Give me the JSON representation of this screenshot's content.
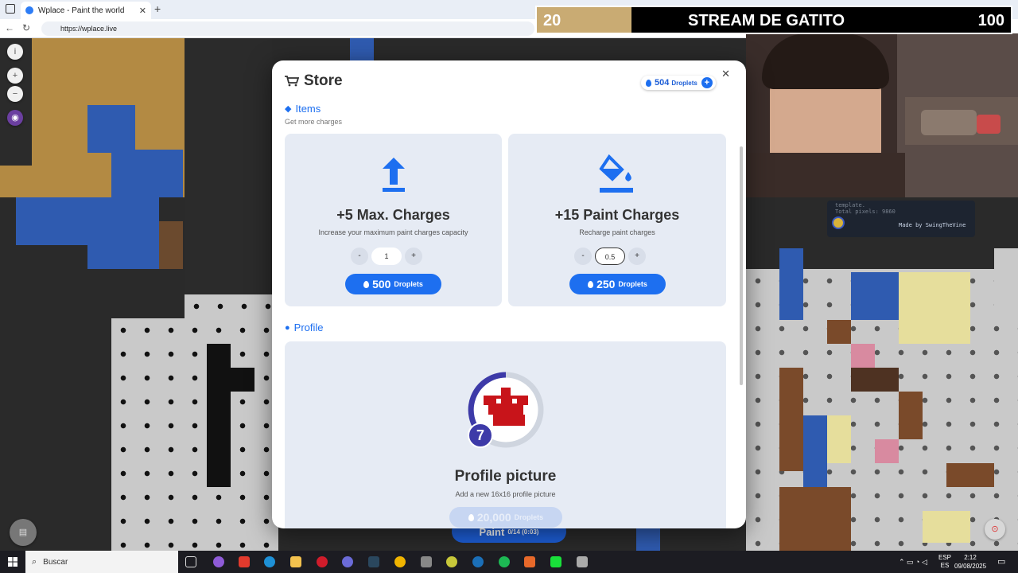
{
  "browser": {
    "tab_title": "Wplace - Paint the world",
    "url": "https://wplace.live"
  },
  "overlay": {
    "left_number": "20",
    "title": "STREAM DE GATITO",
    "right_number": "100",
    "progress": 0.2
  },
  "plugin": {
    "line1": "template.",
    "line2": "Total pixels: 9860",
    "made_by": "Made by SwingTheVine"
  },
  "store": {
    "title": "Store",
    "balance_value": "504",
    "balance_unit": "Droplets",
    "items_title": "Items",
    "items_subtitle": "Get more charges",
    "items": [
      {
        "title": "+5 Max. Charges",
        "desc": "Increase your maximum paint charges capacity",
        "qty": "1",
        "price": "500",
        "unit": "Droplets",
        "icon": "upload-arrow-icon"
      },
      {
        "title": "+15 Paint Charges",
        "desc": "Recharge paint charges",
        "qty": "0.5",
        "price": "250",
        "unit": "Droplets",
        "icon": "paint-bucket-icon"
      }
    ],
    "profile_title": "Profile",
    "profile": {
      "title": "Profile picture",
      "desc": "Add a new 16x16 profile picture",
      "price": "20,000",
      "unit": "Droplets",
      "level": "7"
    }
  },
  "paint_button": {
    "label": "Paint",
    "counts": "0/14 (0:03)"
  },
  "taskbar": {
    "search_label": "Buscar",
    "lang_top": "ESP",
    "lang_bottom": "ES",
    "time": "2:12",
    "date": "09/08/2025"
  }
}
